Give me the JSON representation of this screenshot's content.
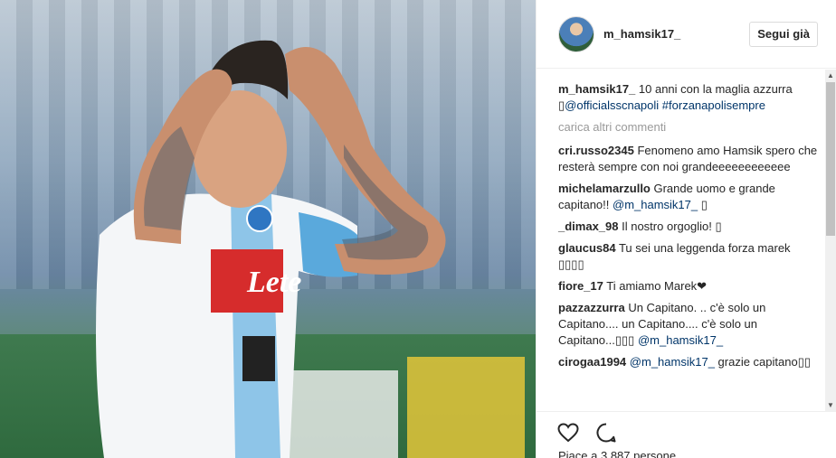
{
  "post": {
    "username": "m_hamsik17_",
    "follow_label": "Segui già",
    "caption": {
      "author": "m_hamsik17_",
      "text": " 10 anni con la maglia azzurra ",
      "emoji": "▯",
      "mention": "@officialsscnapoli",
      "hashtag": "#forzanapolisempre"
    },
    "load_more": "carica altri commenti",
    "comments": [
      {
        "author": "cri.russo2345",
        "text": " Fenomeno amo Hamsik spero che resterà sempre con noi grandeeeeeeeeeeee"
      },
      {
        "author": "michelamarzullo",
        "text": " Grande uomo e grande capitano!! ",
        "mention": "@m_hamsik17_",
        "after": " ▯"
      },
      {
        "author": "_dimax_98",
        "text": " Il nostro orgoglio! ▯"
      },
      {
        "author": "glaucus84",
        "text": " Tu sei una leggenda forza marek ▯▯▯▯"
      },
      {
        "author": "fiore_17",
        "text": " Ti amiamo Marek❤"
      },
      {
        "author": "pazzazzurra",
        "text": " Un Capitano. .. c'è solo un Capitano.... un Capitano.... c'è solo un Capitano...▯▯▯ ",
        "mention": "@m_hamsik17_"
      },
      {
        "author": "cirogaa1994",
        "text": " ",
        "mention": "@m_hamsik17_",
        "after": " grazie capitano▯▯"
      }
    ],
    "likes_text": "Piace a 3.887 persone"
  },
  "photo": {
    "jersey_text": "Lete"
  },
  "icons": [
    "heart-icon",
    "comment-icon"
  ],
  "colors": {
    "link": "#003569",
    "muted": "#999999",
    "text": "#262626"
  }
}
